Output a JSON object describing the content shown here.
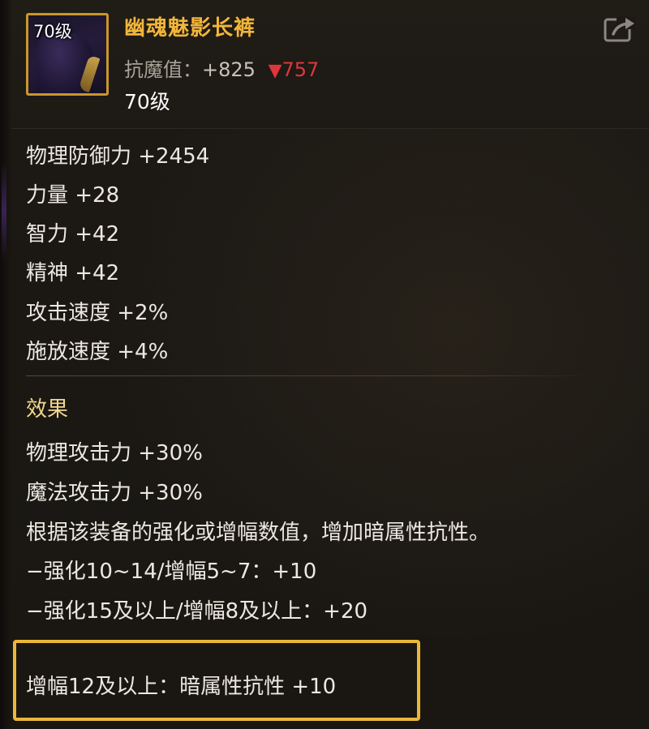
{
  "item": {
    "icon_badge": "70级",
    "name": "幽魂魅影长裤",
    "resist_label": "抗魔值：",
    "resist_value": "+825",
    "resist_compare": "757",
    "level_text": "70级",
    "share_icon": "share-export-icon",
    "name_color": "#f2b63a",
    "compare_color": "#e0353a"
  },
  "stats": [
    "物理防御力 +2454",
    "力量 +28",
    "智力 +42",
    "精神 +42",
    "攻击速度 +2%",
    "施放速度 +4%"
  ],
  "effects": {
    "title": "效果",
    "lines": [
      "物理攻击力 +30%",
      "魔法攻击力 +30%",
      "根据该装备的强化或增幅数值，增加暗属性抗性。",
      "−强化10~14/增幅5~7：+10",
      "−强化15及以上/增幅8及以上：+20"
    ],
    "highlighted": "增幅12及以上：暗属性抗性 +10",
    "highlight_color": "#e9b83a"
  }
}
